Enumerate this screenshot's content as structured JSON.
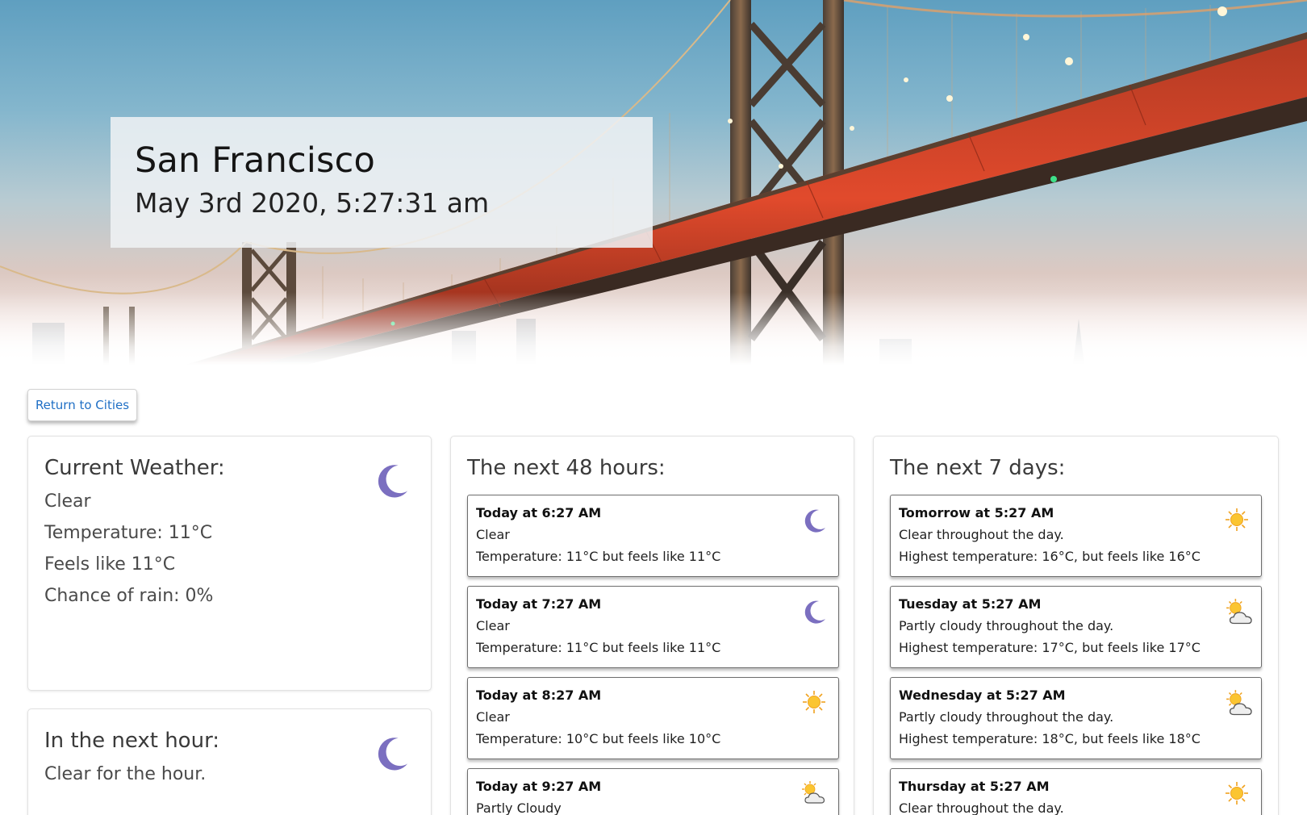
{
  "hero": {
    "city": "San Francisco",
    "datetime": "May 3rd 2020, 5:27:31 am"
  },
  "return_button": "Return to Cities",
  "current": {
    "heading": "Current Weather:",
    "condition": "Clear",
    "temperature": "Temperature: 11°C",
    "feels_like": "Feels like 11°C",
    "rain": "Chance of rain: 0%",
    "icon": "moon-icon"
  },
  "next_hour": {
    "heading": "In the next hour:",
    "summary": "Clear for the hour.",
    "icon": "moon-icon"
  },
  "hours48": {
    "heading": "The next 48 hours:",
    "items": [
      {
        "when": "Today at 6:27 AM",
        "desc": "Clear",
        "temp": "Temperature: 11°C but feels like 11°C",
        "icon": "moon-icon"
      },
      {
        "when": "Today at 7:27 AM",
        "desc": "Clear",
        "temp": "Temperature: 11°C but feels like 11°C",
        "icon": "moon-icon"
      },
      {
        "when": "Today at 8:27 AM",
        "desc": "Clear",
        "temp": "Temperature: 10°C but feels like 10°C",
        "icon": "sun-icon"
      },
      {
        "when": "Today at 9:27 AM",
        "desc": "Partly Cloudy",
        "temp": "",
        "icon": "partly-cloudy-icon"
      }
    ]
  },
  "days7": {
    "heading": "The next 7 days:",
    "items": [
      {
        "when": "Tomorrow at 5:27 AM",
        "desc": "Clear throughout the day.",
        "temp": "Highest temperature: 16°C, but feels like 16°C",
        "icon": "sun-icon"
      },
      {
        "when": "Tuesday at 5:27 AM",
        "desc": "Partly cloudy throughout the day.",
        "temp": "Highest temperature: 17°C, but feels like 17°C",
        "icon": "partly-cloudy-icon"
      },
      {
        "when": "Wednesday at 5:27 AM",
        "desc": "Partly cloudy throughout the day.",
        "temp": "Highest temperature: 18°C, but feels like 18°C",
        "icon": "partly-cloudy-icon"
      },
      {
        "when": "Thursday at 5:27 AM",
        "desc": "Clear throughout the day.",
        "temp": "",
        "icon": "sun-icon"
      }
    ]
  },
  "colors": {
    "moon": "#7b6fc0",
    "sun": "#f5a623",
    "link": "#1f6fc5",
    "bridge": "#c8341f"
  }
}
